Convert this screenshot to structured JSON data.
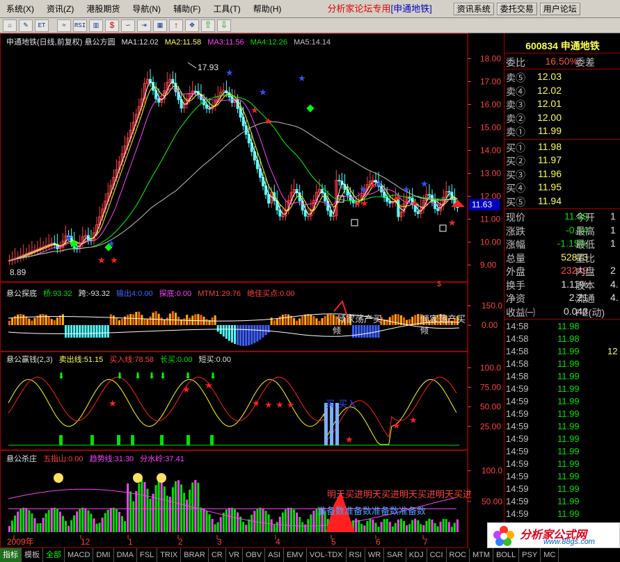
{
  "menu": {
    "items": [
      "系统",
      "资讯",
      "港股期货",
      "导航",
      "辅助",
      "工具",
      "帮助"
    ],
    "shortcuts": [
      "(X)",
      "(Z)",
      "",
      "(N)",
      "(F)",
      "(T)",
      "(H)"
    ],
    "brand": "分析家论坛专用",
    "brand_sub": "[申通地铁]",
    "buttons": [
      "资讯系统",
      "委托交易",
      "用户论坛"
    ]
  },
  "toolbar": {
    "buttons": [
      "home-icon",
      "draw-icon",
      "list-icon",
      "line-chart-icon",
      "rsi-icon",
      "bar-chart-icon",
      "dollar-icon",
      "link-icon",
      "enter-icon",
      "multi-icon",
      "up-arrow-icon",
      "move-icon",
      "up-green-icon",
      "down-green-icon"
    ],
    "labels": [
      "⌂",
      "✎",
      "ET",
      "≈",
      "RSI",
      "▥",
      "$",
      "∽",
      "⇥",
      "▦",
      "↑",
      "✥",
      "⇧",
      "⇩"
    ]
  },
  "main_chart": {
    "title": "申通地铁(日线,前复权) 悬公方圆",
    "ma1": "MA1:12.02",
    "ma2": "MA2:11.58",
    "ma3": "MA3:11.56",
    "ma4": "MA4:12.26",
    "ma5": "MA5:14.14",
    "high_label": "17.93",
    "low_label": "8.89",
    "current_price_tag": "11.63",
    "y_ticks": [
      "18.00",
      "17.00",
      "16.00",
      "15.00",
      "14.00",
      "13.00",
      "12.00",
      "11.00",
      "10.00",
      "9.00"
    ],
    "colors": {
      "ma1": "#ffffff",
      "ma2": "#ffff00",
      "ma3": "#ff00ff",
      "ma4": "#00ff00",
      "ma5": "#c0c0c0"
    }
  },
  "panel1": {
    "name": "悬公探底",
    "items": [
      "桥:93.32",
      "跨:-93.32",
      "输出4:0.00",
      "探底:0.00",
      "MTM1:29.76",
      "绝佳买点:0.00"
    ],
    "y_ticks": [
      "150.0",
      "0.00"
    ],
    "texts": [
      "倾家荡产买",
      "倾家荡产买",
      "倾",
      "倾"
    ]
  },
  "panel2": {
    "name": "悬公赢钱(2,3)",
    "items": [
      "卖出线:51.15",
      "买入线:78.58",
      "长买:0.00",
      "短买:0.00"
    ],
    "y_ticks": [
      "100.0",
      "75.00",
      "50.00",
      "25.00"
    ],
    "texts": [
      "买",
      "买入"
    ]
  },
  "panel3": {
    "name": "悬公杀庄",
    "items": [
      "五指山:0.00",
      "趋势线:31.30",
      "分水岭:37.41"
    ],
    "y_ticks": [
      "100.0",
      "50.00"
    ],
    "texts": [
      "明天买进明天买进明天买进明天买进",
      "准备数准备数准备数准备数"
    ]
  },
  "x_axis": [
    "2009年",
    "12",
    "1",
    "2",
    "3",
    "4",
    "5",
    "6",
    "7"
  ],
  "info": {
    "code": "600834 申通地铁",
    "webi": {
      "label": "委比",
      "value": "16.50%",
      "label2": "委差"
    },
    "sell": [
      {
        "label": "卖⑤",
        "price": "12.03"
      },
      {
        "label": "卖④",
        "price": "12.02"
      },
      {
        "label": "卖③",
        "price": "12.01"
      },
      {
        "label": "卖②",
        "price": "12.00"
      },
      {
        "label": "卖①",
        "price": "11.99"
      }
    ],
    "buy": [
      {
        "label": "买①",
        "price": "11.98"
      },
      {
        "label": "买②",
        "price": "11.97"
      },
      {
        "label": "买③",
        "price": "11.96"
      },
      {
        "label": "买④",
        "price": "11.95"
      },
      {
        "label": "买⑤",
        "price": "11.94"
      }
    ],
    "stats": [
      {
        "label": "现价",
        "value": "11.99",
        "label2": "今开",
        "value2": "1",
        "c1": "grn"
      },
      {
        "label": "涨跌",
        "value": "-0.14",
        "label2": "最高",
        "value2": "1",
        "c1": "grn"
      },
      {
        "label": "涨幅",
        "value": "-1.15%",
        "label2": "最低",
        "value2": "1",
        "c1": "grn"
      },
      {
        "label": "总量",
        "value": "52873",
        "label2": "量比",
        "value2": "",
        "c1": "yel"
      },
      {
        "label": "外盘",
        "value": "23249",
        "label2": "内盘",
        "value2": "2",
        "c1": "red"
      },
      {
        "label": "换手",
        "value": "1.11%",
        "label2": "股本",
        "value2": "4.",
        "c1": "wht"
      },
      {
        "label": "净资",
        "value": "2.21",
        "label2": "流通",
        "value2": "4.",
        "c1": "wht"
      },
      {
        "label": "收益㈠",
        "value": "0.043",
        "label2": "PE(动)",
        "value2": "",
        "c1": "wht"
      }
    ],
    "ticks": [
      {
        "t": "14:58",
        "p": "11.98",
        "q": ""
      },
      {
        "t": "14:58",
        "p": "11.98",
        "q": ""
      },
      {
        "t": "14:58",
        "p": "11.99",
        "q": "12"
      },
      {
        "t": "14:58",
        "p": "11.99",
        "q": ""
      },
      {
        "t": "14:58",
        "p": "11.99",
        "q": ""
      },
      {
        "t": "14:59",
        "p": "11.99",
        "q": ""
      },
      {
        "t": "14:59",
        "p": "11.99",
        "q": ""
      },
      {
        "t": "14:59",
        "p": "11.99",
        "q": ""
      },
      {
        "t": "14:59",
        "p": "11.99",
        "q": ""
      },
      {
        "t": "14:59",
        "p": "11.99",
        "q": ""
      },
      {
        "t": "14:59",
        "p": "11.99",
        "q": ""
      },
      {
        "t": "14:59",
        "p": "11.99",
        "q": ""
      },
      {
        "t": "14:59",
        "p": "11.99",
        "q": ""
      },
      {
        "t": "14:59",
        "p": "11.99",
        "q": ""
      },
      {
        "t": "14:59",
        "p": "11.99",
        "q": ""
      },
      {
        "t": "14:59",
        "p": "11.99",
        "q": ""
      },
      {
        "t": "14:59",
        "p": "11.99",
        "q": ""
      }
    ]
  },
  "tabs": [
    "指标",
    "模板",
    "全部",
    "MACD",
    "DMI",
    "DMA",
    "FSL",
    "TRIX",
    "BRAR",
    "CR",
    "VR",
    "OBV",
    "ASI",
    "EMV",
    "VOL-TDX",
    "RSI",
    "WR",
    "SAR",
    "KDJ",
    "CCI",
    "ROC",
    "MTM",
    "BOLL",
    "PSY",
    "MC"
  ],
  "watermark": {
    "title": "分析家公式网",
    "url": "www.88gs.com"
  }
}
